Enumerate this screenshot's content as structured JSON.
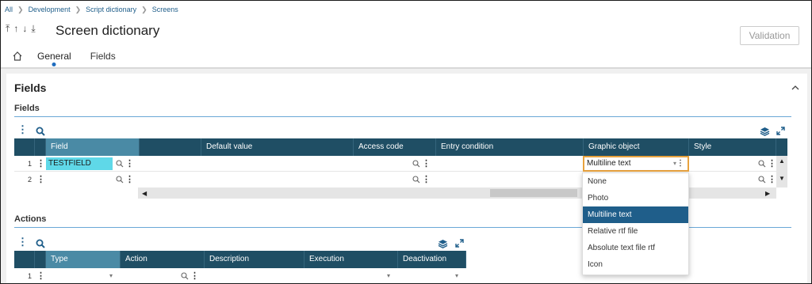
{
  "breadcrumb": [
    "All",
    "Development",
    "Script dictionary",
    "Screens"
  ],
  "header": {
    "title": "Screen dictionary",
    "validation_label": "Validation",
    "nav_icons": [
      "first-record-icon",
      "previous-record-icon",
      "next-record-icon",
      "last-record-icon"
    ]
  },
  "tabs": {
    "home_icon": "home-icon",
    "items": [
      "General",
      "Fields"
    ],
    "active": "General"
  },
  "section": {
    "title": "Fields",
    "fields_subtitle": "Fields",
    "actions_subtitle": "Actions"
  },
  "fields_grid": {
    "columns": [
      "Field",
      "Default value",
      "Access code",
      "Entry condition",
      "Graphic object",
      "Style"
    ],
    "rows": [
      {
        "num": "1",
        "field": "TESTFIELD",
        "graphic_object": "Multiline text"
      },
      {
        "num": "2",
        "field": "",
        "graphic_object": ""
      }
    ]
  },
  "graphic_dropdown": {
    "options": [
      "None",
      "Photo",
      "Multiline text",
      "Relative rtf file",
      "Absolute text file rtf",
      "Icon"
    ],
    "selected": "Multiline text"
  },
  "actions_grid": {
    "columns": [
      "Type",
      "Action",
      "Description",
      "Execution",
      "Deactivation"
    ],
    "rows": [
      {
        "num": "1"
      }
    ]
  },
  "colors": {
    "header_bg": "#1f4e64",
    "selected_header": "#4a8aa5",
    "accent": "#1f5e8a",
    "field_highlight": "#5fd8e8",
    "focus_border": "#e8a23d"
  }
}
